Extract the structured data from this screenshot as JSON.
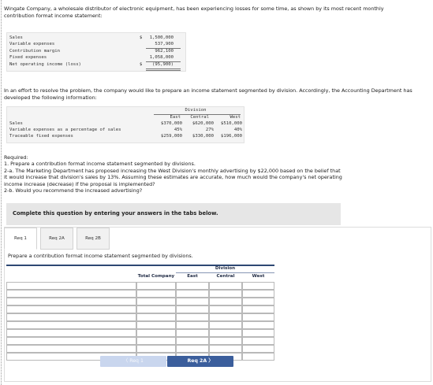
{
  "intro": "Wingate Company, a wholesale distributor of electronic equipment, has been experiencing losses for some time, as shown by its most recent monthly contribution format income statement:",
  "statement1": {
    "rows": [
      {
        "label": "Sales",
        "currency": "$",
        "value": "1,500,000"
      },
      {
        "label": "Variable expenses",
        "currency": "",
        "value": "537,900"
      },
      {
        "label": "Contribution margin",
        "currency": "",
        "value": "962,100"
      },
      {
        "label": "Fixed expenses",
        "currency": "",
        "value": "1,058,000"
      },
      {
        "label": "Net operating income (loss)",
        "currency": "$",
        "value": "(95,900)"
      }
    ]
  },
  "para2": "In an effort to resolve the problem, the company would like to prepare an income statement segmented by division. Accordingly, the Accounting Department has developed the following information:",
  "statement2": {
    "group_header": "Division",
    "columns": [
      "East",
      "Central",
      "West"
    ],
    "rows": [
      {
        "label": "Sales",
        "values": [
          "$370,000",
          "$620,000",
          "$510,000"
        ]
      },
      {
        "label": "Variable expenses as a percentage of sales",
        "values": [
          "45%",
          "27%",
          "40%"
        ]
      },
      {
        "label": "Traceable fixed expenses",
        "values": [
          "$259,000",
          "$330,000",
          "$196,000"
        ]
      }
    ]
  },
  "required": {
    "heading": "Required:",
    "line1": "1. Prepare a contribution format income statement segmented by divisions.",
    "line2a": "2-a. The Marketing Department has proposed increasing the West Division's monthly advertising by $22,000 based on the belief that",
    "line2b": "it would increase that division's sales by 13%. Assuming these estimates are accurate, how much would the company's net operating",
    "line2c": "income increase (decrease) if the proposal is implemented?",
    "line3": "2-b. Would you recommend the increased advertising?"
  },
  "instruction": "Complete this question by entering your answers in the tabs below.",
  "tabs": [
    {
      "label": "Req 1"
    },
    {
      "label": "Req 2A"
    },
    {
      "label": "Req 2B"
    }
  ],
  "prompt": "Prepare a contribution format income statement segmented by divisions.",
  "answer_table": {
    "group_header": "Division",
    "headers": [
      "Total Company",
      "East",
      "Central",
      "West"
    ]
  },
  "nav": {
    "prev_label": "〈  Req 1",
    "next_label": "Req 2A  〉"
  },
  "colors": {
    "header_bar": "#2e4873",
    "next_button": "#3b5e9c",
    "prev_button": "#c9d6ee"
  }
}
